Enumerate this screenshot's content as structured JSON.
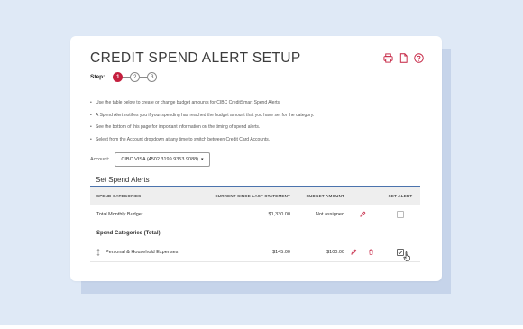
{
  "page": {
    "title": "CREDIT SPEND ALERT SETUP",
    "icons": [
      "print-icon",
      "document-icon",
      "help-icon"
    ],
    "accent_color": "#c41f3e",
    "rule_color": "#4b73ad"
  },
  "stepper": {
    "label": "Step:",
    "steps": [
      "1",
      "2",
      "3"
    ],
    "active_step": "1"
  },
  "instructions": [
    "Use the table below to create or change budget amounts for CIBC CreditSmart Spend Alerts.",
    "A Spend Alert notifies you if your spending has reached the budget amount that you have set for the category.",
    "See the bottom of this page for important information on the timing of spend alerts.",
    "Select from the Account dropdown at any time to switch between Credit Card Accounts."
  ],
  "account": {
    "label": "Account:",
    "selected": "CIBC VISA (4502 3199 9353 9088)"
  },
  "section": {
    "title": "Set Spend Alerts"
  },
  "table": {
    "headers": {
      "category": "SPEND CATEGORIES",
      "current": "CURRENT SINCE LAST STATEMENT",
      "budget": "BUDGET AMOUNT",
      "alert": "SET ALERT"
    },
    "total_row": {
      "category": "Total Monthly Budget",
      "current": "$1,330.00",
      "budget": "Not assigned",
      "alert_checked": false
    },
    "group_row": {
      "label": "Spend Categories (Total)"
    },
    "category_row": {
      "category": "Personal & Household Expenses",
      "current": "$145.00",
      "budget": "$100.00",
      "alert_checked": true
    }
  }
}
